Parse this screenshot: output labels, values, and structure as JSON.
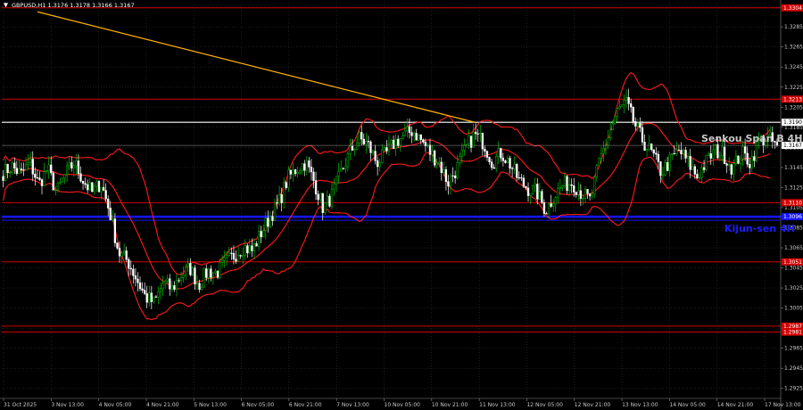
{
  "header": {
    "symbol_text": "GBPUSD,H1  1.3176 1.3178 1.3166 1.3167"
  },
  "colors": {
    "background": "#000000",
    "bull": "#00c000",
    "bear": "#ffffff",
    "band": "#ff1a1a",
    "level_red": "#d40000",
    "level_blue": "#1414ff",
    "level_white": "#ffffff",
    "trend": "#ffb300",
    "grid": "#3a3a3a",
    "text": "#c8c8c8"
  },
  "chart_data": {
    "type": "candlestick",
    "symbol": "GBPUSD",
    "timeframe": "H1",
    "ylim": [
      1.2915,
      1.331
    ],
    "y_ticks": [
      "1.3305",
      "1.3285",
      "1.3265",
      "1.3245",
      "1.3225",
      "1.3205",
      "1.3185",
      "1.3165",
      "1.3145",
      "1.3125",
      "1.3105",
      "1.3085",
      "1.3065",
      "1.3045",
      "1.3025",
      "1.3005",
      "1.2985",
      "1.2965",
      "1.2945",
      "1.2925"
    ],
    "x_ticks": [
      "31 Oct 2025",
      "3 Nov 13:00",
      "4 Nov 05:00",
      "4 Nov 21:00",
      "5 Nov 13:00",
      "6 Nov 05:00",
      "6 Nov 21:00",
      "7 Nov 13:00",
      "10 Nov 05:00",
      "10 Nov 21:00",
      "11 Nov 13:00",
      "12 Nov 05:00",
      "12 Nov 21:00",
      "13 Nov 13:00",
      "14 Nov 05:00",
      "14 Nov 21:00",
      "17 Nov 13:00"
    ],
    "current_price": "1.3167",
    "close_path": [
      1.314,
      1.3146,
      1.3138,
      1.315,
      1.3128,
      1.3144,
      1.312,
      1.3138,
      1.315,
      1.3132,
      1.312,
      1.313,
      1.31,
      1.306,
      1.3052,
      1.3034,
      1.3016,
      1.301,
      1.303,
      1.3024,
      1.3038,
      1.3045,
      1.3028,
      1.3042,
      1.304,
      1.305,
      1.3058,
      1.3066,
      1.3062,
      1.308,
      1.3096,
      1.311,
      1.3134,
      1.3144,
      1.315,
      1.313,
      1.3104,
      1.3118,
      1.314,
      1.316,
      1.3174,
      1.3168,
      1.315,
      1.3158,
      1.317,
      1.3176,
      1.3182,
      1.3172,
      1.316,
      1.315,
      1.313,
      1.3144,
      1.3164,
      1.3178,
      1.317,
      1.315,
      1.316,
      1.3148,
      1.3132,
      1.3124,
      1.312,
      1.3102,
      1.3118,
      1.3128,
      1.313,
      1.312,
      1.3112,
      1.315,
      1.3176,
      1.32,
      1.321,
      1.3188,
      1.317,
      1.3158,
      1.314,
      1.3152,
      1.3162,
      1.315,
      1.3136,
      1.315,
      1.3162,
      1.3158,
      1.3144,
      1.316,
      1.315,
      1.3172,
      1.3174,
      1.3167
    ],
    "levels": [
      {
        "price": 1.3304,
        "label": "1.3304",
        "color": "level_red"
      },
      {
        "price": 1.3213,
        "label": "1.3213",
        "color": "level_red"
      },
      {
        "price": 1.319,
        "label": "1.3190",
        "color": "level_white"
      },
      {
        "price": 1.311,
        "label": "1.3110",
        "color": "level_red"
      },
      {
        "price": 1.3096,
        "label": "1.3096",
        "color": "level_blue"
      },
      {
        "price": 1.3051,
        "label": "1.3051",
        "color": "level_red"
      },
      {
        "price": 1.2987,
        "label": "1.2987",
        "color": "level_red"
      },
      {
        "price": 1.2981,
        "label": "1.2981",
        "color": "level_red"
      }
    ],
    "labels": {
      "senkou": "Senkou Span B 4H",
      "kijun": "Kijun-sen 4H"
    },
    "trend_line": {
      "start_price": 1.33,
      "end_price": 1.319,
      "start_index": 0,
      "end_index": 71
    }
  }
}
